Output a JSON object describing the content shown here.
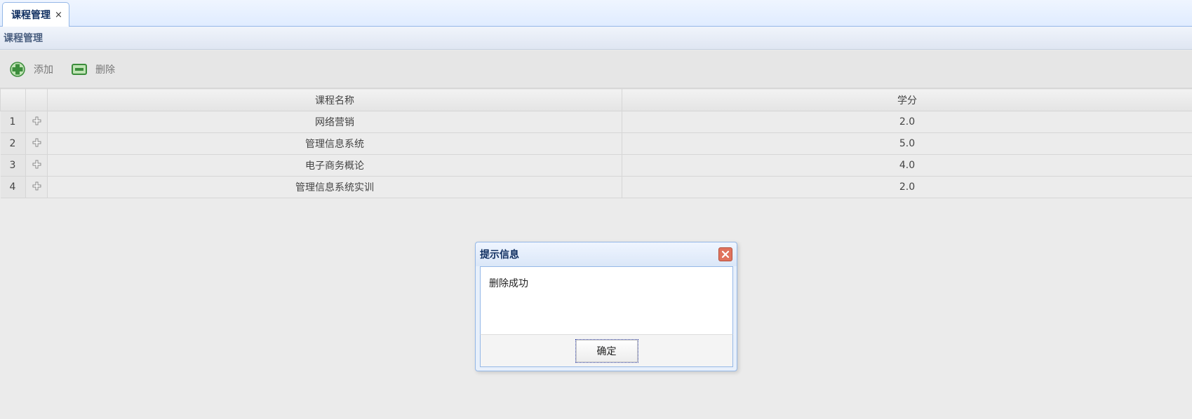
{
  "tabs": [
    {
      "title": "课程管理",
      "close": "×"
    }
  ],
  "panel": {
    "title": "课程管理"
  },
  "toolbar": {
    "add_label": "添加",
    "add_icon": "add-icon",
    "delete_label": "删除",
    "delete_icon": "remove-icon"
  },
  "grid": {
    "columns": [
      "课程名称",
      "学分"
    ],
    "rows": [
      {
        "num": "1",
        "name": "网络营销",
        "credit": "2.0"
      },
      {
        "num": "2",
        "name": "管理信息系统",
        "credit": "5.0"
      },
      {
        "num": "3",
        "name": "电子商务概论",
        "credit": "4.0"
      },
      {
        "num": "4",
        "name": "管理信息系统实训",
        "credit": "2.0"
      }
    ]
  },
  "dialog": {
    "title": "提示信息",
    "message": "删除成功",
    "ok_label": "确定"
  },
  "colors": {
    "accent_border": "#95b8e7",
    "close_button": "#e0735e",
    "add_icon_green": "#3c8d3c"
  }
}
